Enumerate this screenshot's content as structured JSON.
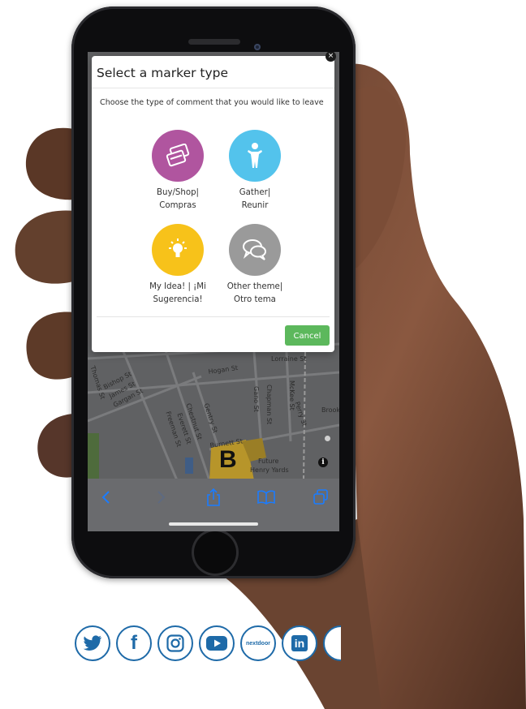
{
  "modal": {
    "title": "Select a marker type",
    "description": "Choose the type of comment that you would like to leave",
    "close_glyph": "×",
    "options": [
      {
        "label_line1": "Buy/Shop|",
        "label_line2": "Compras",
        "icon": "shopping-cards-icon",
        "color": "#b0559f"
      },
      {
        "label_line1": "Gather|",
        "label_line2": "Reunir",
        "icon": "person-icon",
        "color": "#53c3ec"
      },
      {
        "label_line1": "My Idea! | ¡Mi",
        "label_line2": "Sugerencia!",
        "icon": "lightbulb-icon",
        "color": "#f7c21a"
      },
      {
        "label_line1": "Other theme|",
        "label_line2": "Otro tema",
        "icon": "speech-bubbles-icon",
        "color": "#9a9a9a"
      }
    ],
    "cancel_label": "Cancel",
    "cancel_color": "#5cb85c"
  },
  "map": {
    "streets": [
      "Lorraine St",
      "Hogan St",
      "Thomas St",
      "Bishop St",
      "James St",
      "Gargan St",
      "Chestnut St",
      "Everett St",
      "Freeman St",
      "Gentry St",
      "Gano St",
      "McKee St",
      "Chapman St",
      "Perry St",
      "Burnett St",
      "Future",
      "Henry Yards",
      "Brook"
    ],
    "marker_letter": "B",
    "info_glyph": "i"
  },
  "browser_toolbar": {
    "icons": [
      "back-icon",
      "forward-icon",
      "share-icon",
      "bookmarks-icon",
      "tabs-icon"
    ],
    "icon_color": "#1a7cff"
  },
  "socials": {
    "icons": [
      "twitter-icon",
      "facebook-icon",
      "instagram-icon",
      "youtube-icon",
      "nextdoor-icon",
      "linkedin-icon",
      "partial-icon"
    ],
    "nextdoor_text": "nextdoor",
    "linkedin_text": "in",
    "facebook_text": "f",
    "color": "#1e6aa8"
  }
}
